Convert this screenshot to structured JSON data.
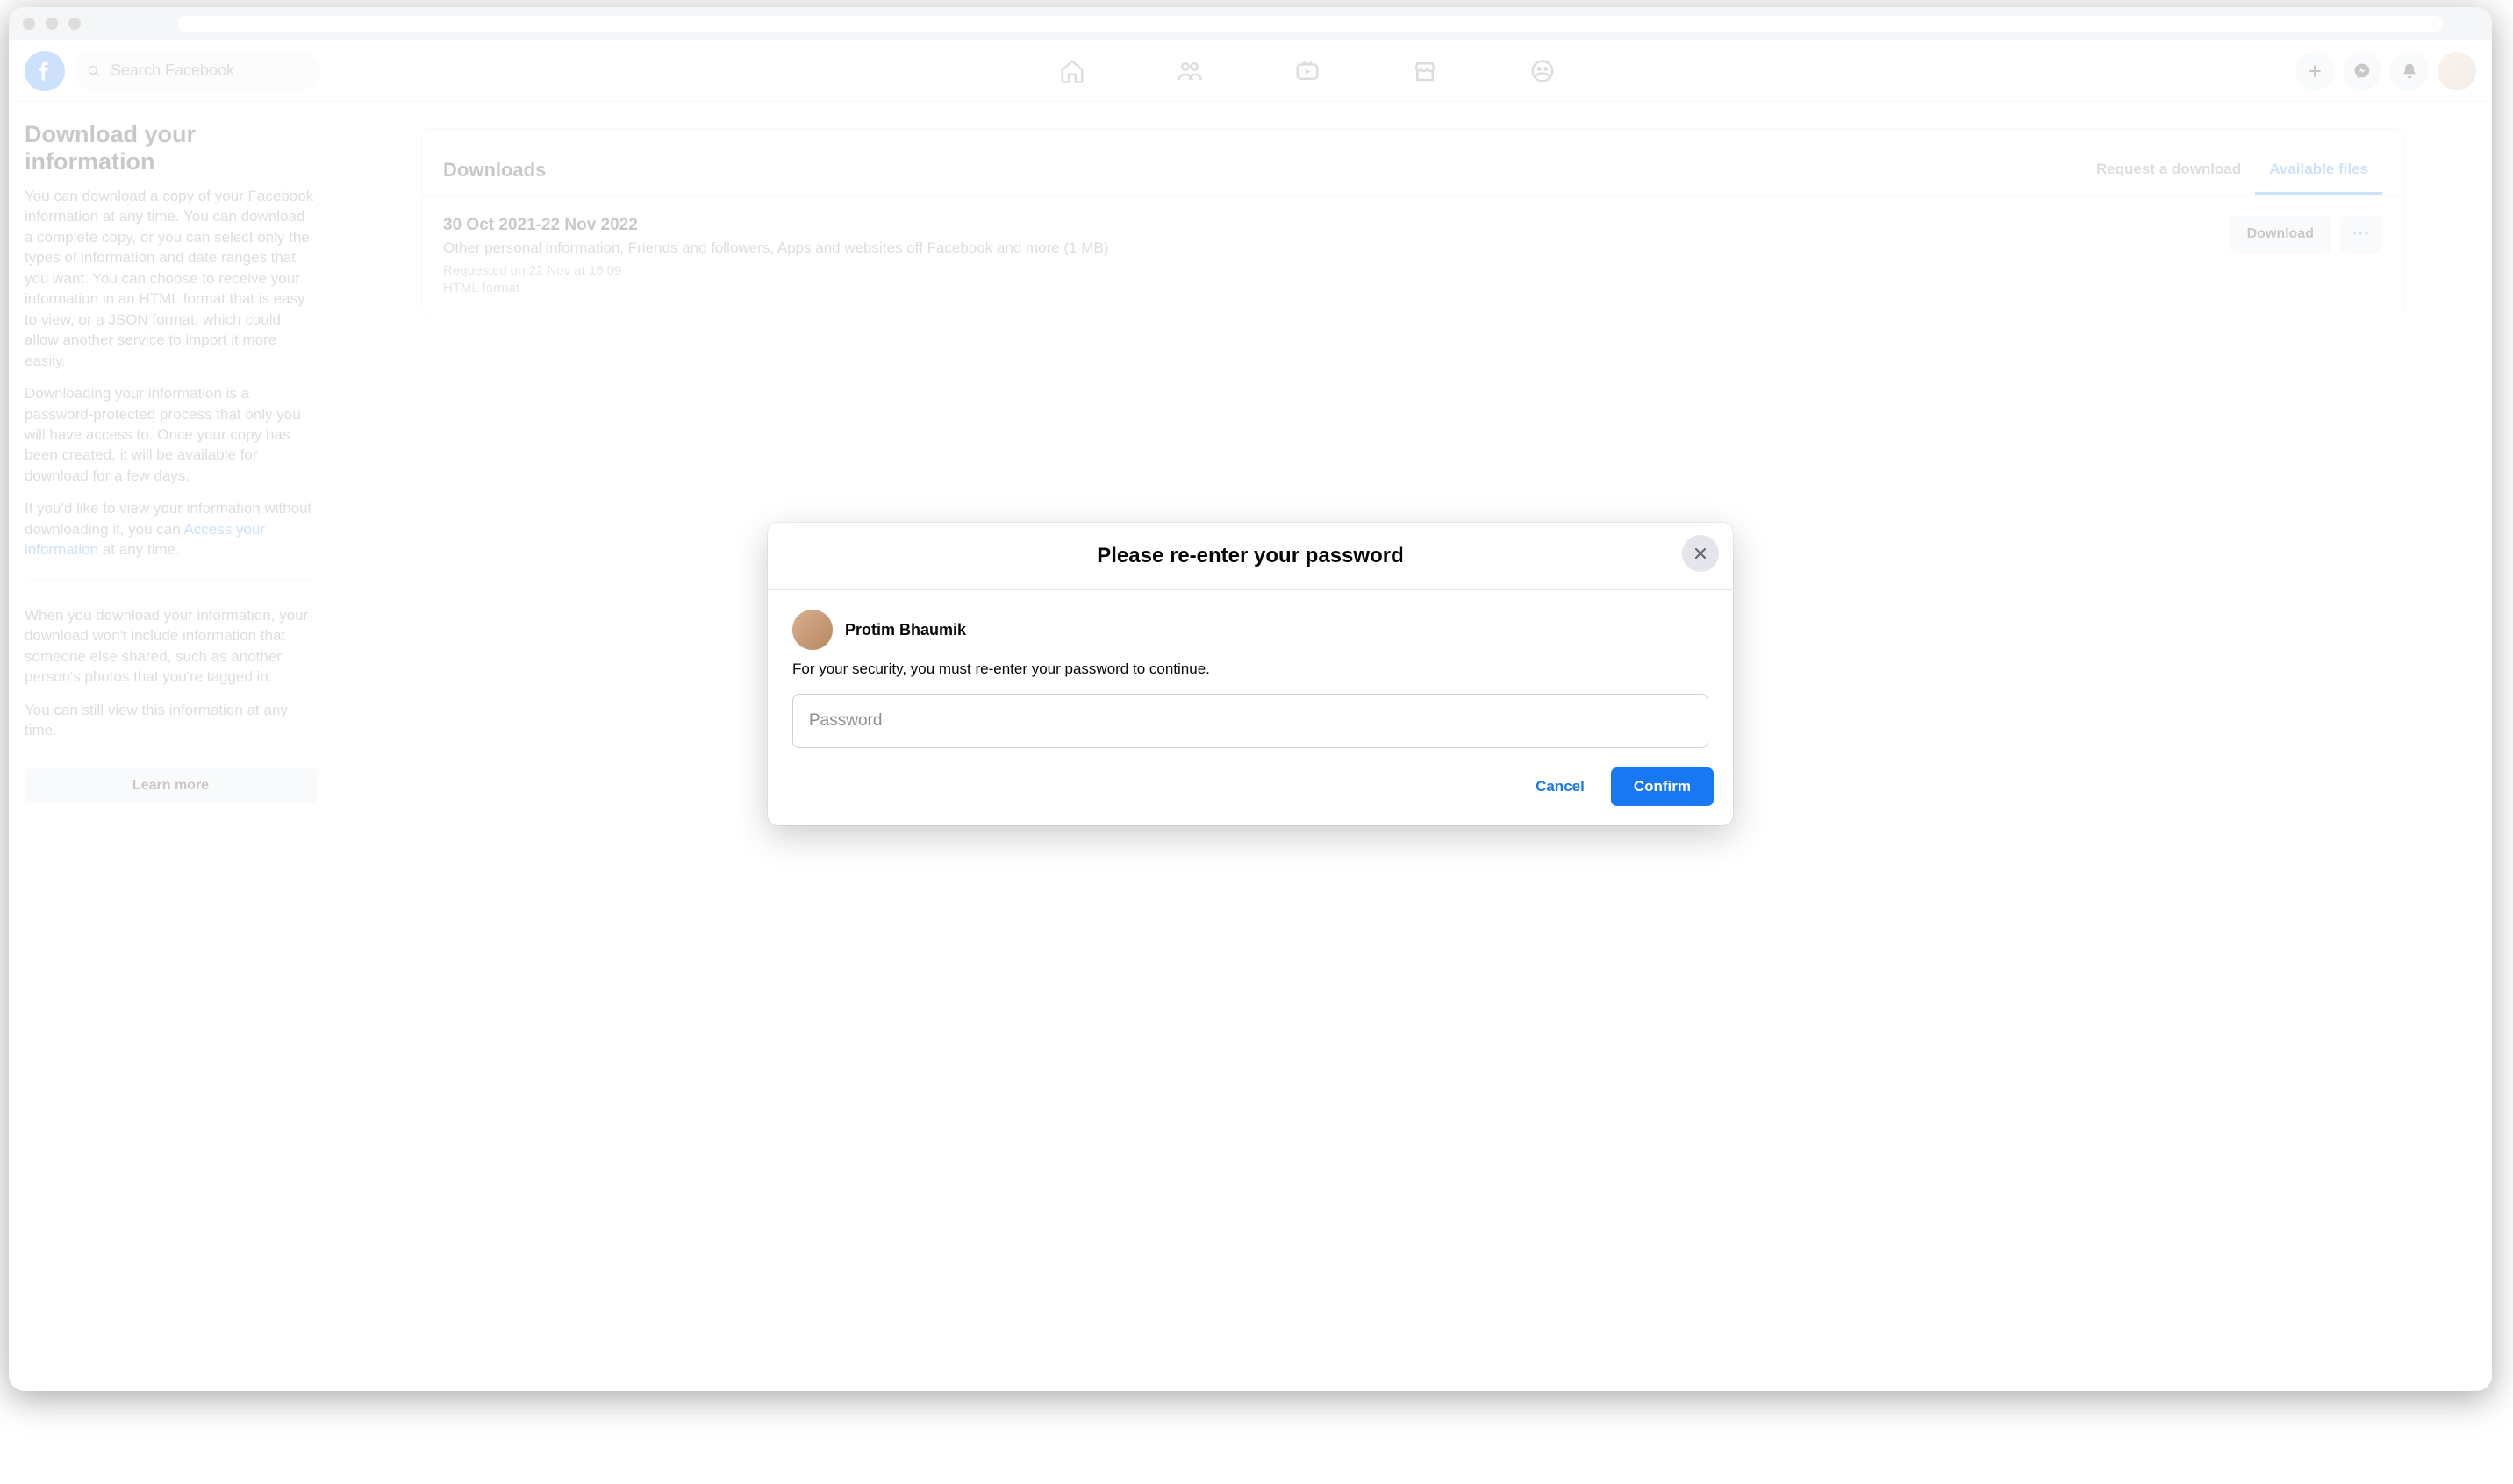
{
  "header": {
    "search_placeholder": "Search Facebook"
  },
  "sidebar": {
    "title": "Download your information",
    "para1": "You can download a copy of your Facebook information at any time. You can download a complete copy, or you can select only the types of information and date ranges that you want. You can choose to receive your information in an HTML format that is easy to view, or a JSON format, which could allow another service to import it more easily.",
    "para2": "Downloading your information is a password-protected process that only you will have access to. Once your copy has been created, it will be available for download for a few days.",
    "para3_prefix": "If you'd like to view your information without downloading it, you can ",
    "para3_link": "Access your information",
    "para3_suffix": " at any time.",
    "note1": "When you download your information, your download won't include information that someone else shared, such as another person's photos that you're tagged in.",
    "note2": "You can still view this information at any time.",
    "learn_more": "Learn more"
  },
  "downloads": {
    "heading": "Downloads",
    "tab_request": "Request a download",
    "tab_available": "Available files",
    "file": {
      "title": "30 Oct 2021-22 Nov 2022",
      "desc": "Other personal information, Friends and followers, Apps and websites off Facebook and more (1 MB)",
      "requested": "Requested on 22 Nov at 16:09",
      "format": "HTML format",
      "download_label": "Download",
      "more_label": "···"
    }
  },
  "modal": {
    "title": "Please re-enter your password",
    "user_name": "Protim Bhaumik",
    "desc": "For your security, you must re-enter your password to continue.",
    "password_placeholder": "Password",
    "cancel": "Cancel",
    "confirm": "Confirm"
  }
}
